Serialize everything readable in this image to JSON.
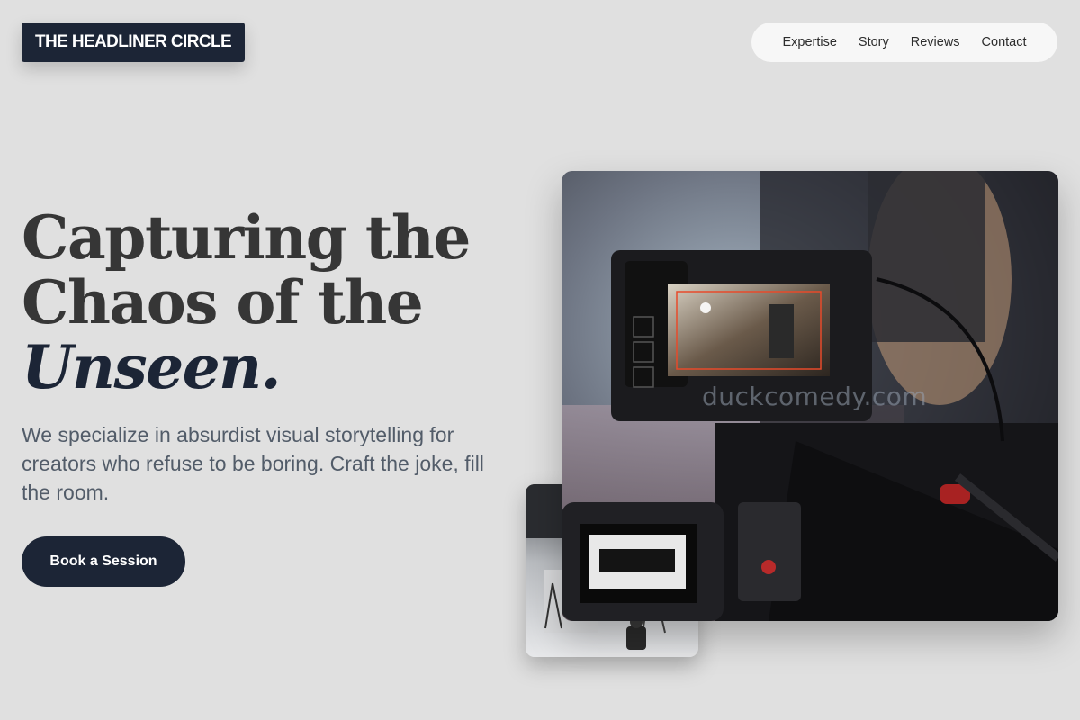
{
  "brand": {
    "name": "THE HEADLINER CIRCLE"
  },
  "nav": {
    "items": [
      {
        "label": "Expertise"
      },
      {
        "label": "Story"
      },
      {
        "label": "Reviews"
      },
      {
        "label": "Contact"
      }
    ]
  },
  "hero": {
    "headline_line1": "Capturing the",
    "headline_line2": "Chaos of the",
    "headline_accent": "Unseen.",
    "subtitle": "We specialize in absurdist visual storytelling for creators who refuse to be boring. Craft the joke, fill the room.",
    "cta_label": "Book a Session"
  },
  "images": {
    "main": {
      "subject": "camera-rig-with-monitor-photo",
      "watermark": "duckcomedy.com"
    },
    "secondary": {
      "subject": "film-studio-set-photo"
    }
  },
  "colors": {
    "background": "#e0e0e0",
    "navy": "#1c2536",
    "headline": "#363636",
    "subtitle": "#525c69",
    "nav_pill": "#f7f7f7"
  }
}
